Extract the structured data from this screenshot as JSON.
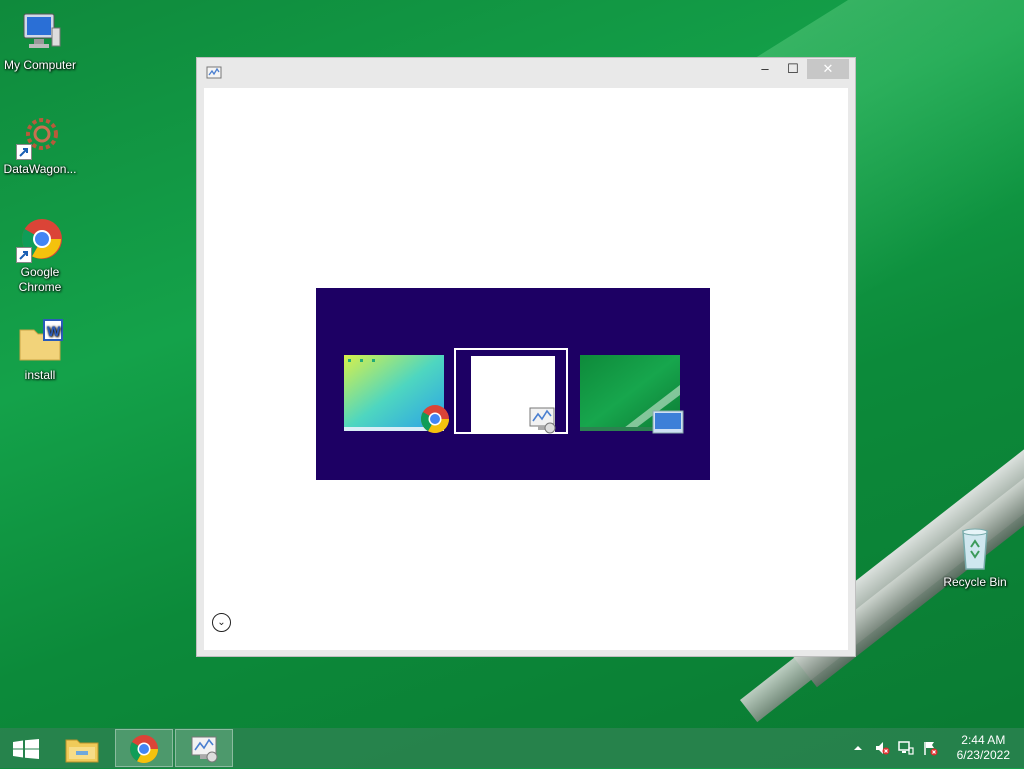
{
  "desktop": {
    "icons": [
      {
        "label": "My Computer"
      },
      {
        "label": "DataWagon..."
      },
      {
        "label": "Google\nChrome"
      },
      {
        "label": "install"
      },
      {
        "label": "Recycle Bin"
      }
    ]
  },
  "window": {
    "controls": {
      "minimize": "–",
      "maximize": "☐",
      "close": "✕"
    },
    "expand_icon": "⌄"
  },
  "taskbar": {
    "clock": {
      "time": "2:44 AM",
      "date": "6/23/2022"
    }
  },
  "colors": {
    "switcher_bg": "#1d0064",
    "taskbar": "#2c8250",
    "accent_green": "#14a24a"
  }
}
